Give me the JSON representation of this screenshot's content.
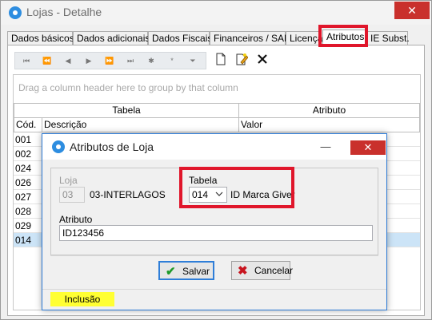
{
  "window": {
    "title": "Lojas - Detalhe",
    "close_glyph": "✕",
    "icon": "app-logo-icon"
  },
  "tabs": [
    {
      "label": "Dados básicos",
      "active": false
    },
    {
      "label": "Dados adicionais",
      "active": false
    },
    {
      "label": "Dados Fiscais",
      "active": false
    },
    {
      "label": "Financeiros / SAP",
      "active": false
    },
    {
      "label": "Licença",
      "active": false
    },
    {
      "label": "Atributos",
      "active": true
    },
    {
      "label": "IE Subst.",
      "active": false
    }
  ],
  "toolbar": {
    "nav_glyphs": [
      "⏮",
      "⏪",
      "◀",
      "▶",
      "⏩",
      "⏭",
      "✱",
      "*",
      "⏷"
    ],
    "new_icon": "new-document-icon",
    "edit_icon": "edit-document-icon",
    "delete_icon": "delete-icon"
  },
  "grid": {
    "group_hint": "Drag a column header here to group by that column",
    "bands": {
      "tabela": "Tabela",
      "atributo": "Atributo"
    },
    "columns": {
      "cod": "Cód.",
      "descricao": "Descrição",
      "valor": "Valor"
    },
    "rows": [
      {
        "cod": "001"
      },
      {
        "cod": "002"
      },
      {
        "cod": "024"
      },
      {
        "cod": "026"
      },
      {
        "cod": "027"
      },
      {
        "cod": "028"
      },
      {
        "cod": "029"
      },
      {
        "cod": "014"
      }
    ]
  },
  "dialog": {
    "title": "Atributos de Loja",
    "minimize_glyph": "—",
    "close_glyph": "✕",
    "loja_label": "Loja",
    "loja_code": "03",
    "loja_name": "03-INTERLAGOS",
    "tabela_label": "Tabela",
    "tabela_value": "014",
    "tabela_desc": "ID Marca Giver",
    "atributo_label": "Atributo",
    "atributo_value": "ID123456",
    "save_label": "Salvar",
    "cancel_label": "Cancelar",
    "status": "Inclusão"
  },
  "colors": {
    "highlight": "#e0162b",
    "accent": "#2b79d4",
    "selected_row": "#cce4f7",
    "status_badge": "#ffff33",
    "close_button": "#c9302c"
  }
}
